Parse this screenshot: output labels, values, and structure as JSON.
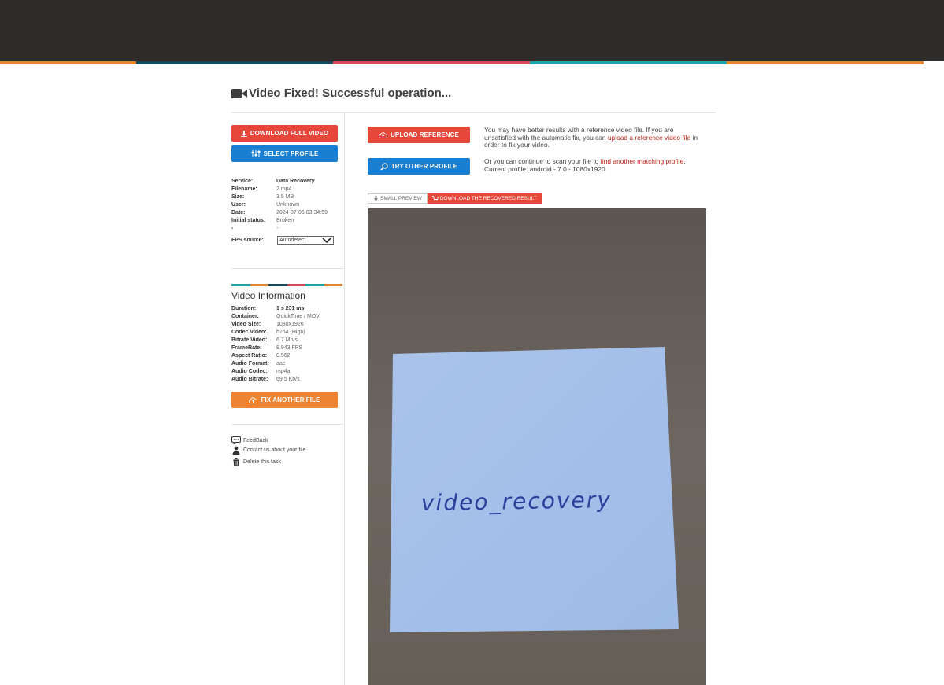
{
  "header": {
    "stripe_colors": [
      "#e58630",
      "#16485c",
      "#d8485a",
      "#1ba7a7",
      "#e58630"
    ]
  },
  "page": {
    "title": "Video Fixed! Successful operation..."
  },
  "actions": {
    "download_full_video": "DOWNLOAD FULL VIDEO",
    "select_profile": "SELECT PROFILE",
    "upload_reference": "UPLOAD REFERENCE",
    "try_other_profile": "TRY OTHER PROFILE",
    "fix_another_file": "FIX ANOTHER FILE"
  },
  "file_info": {
    "service_label": "Service:",
    "service": "Data Recovery",
    "filename_label": "Filename:",
    "filename": "2.mp4",
    "size_label": "Size:",
    "size": "3.5 MB",
    "user_label": "User:",
    "user": "Unknown",
    "date_label": "Date:",
    "date": "2024-07-05 03:34:59",
    "initial_status_label": "Initial status:",
    "initial_status": "Broken",
    "dash_label": "-",
    "dash_value": "-",
    "fps_source_label": "FPS source:",
    "fps_source": "Autodetect"
  },
  "video_info": {
    "title": "Video Information",
    "duration_label": "Duration:",
    "duration": "1 s 231 ms",
    "container_label": "Container:",
    "container": "QuickTime / MOV",
    "video_size_label": "Video Size:",
    "video_size": "1080x1920",
    "codec_video_label": "Codec Video:",
    "codec_video": "h264 (High)",
    "bitrate_video_label": "Bitrate Video:",
    "bitrate_video": "6.7 Mb/s",
    "framerate_label": "FrameRate:",
    "framerate": "8.943 FPS",
    "aspect_ratio_label": "Aspect Ratio:",
    "aspect_ratio": "0.562",
    "audio_format_label": "Audio Format:",
    "audio_format": "aac",
    "audio_codec_label": "Audio Codec:",
    "audio_codec": "mp4a",
    "audio_bitrate_label": "Audio Bitrate:",
    "audio_bitrate": "69.5 Kb/s"
  },
  "links": {
    "feedback": "FeedBack",
    "contact": "Contact us about your file",
    "delete": "Delete this task"
  },
  "notes": {
    "reference_pre": "You may have better results with a reference video file. If you are unsatisfied with the automatic fix, you can ",
    "reference_link": "upload a reference video file",
    "reference_post": " in order to fix your video.",
    "profile_pre": "Or you can continue to scan your file to ",
    "profile_link": "find another matching profile",
    "profile_post": ". Current profile: android - 7.0 - 1080x1920"
  },
  "preview_tabs": {
    "small_preview": "SMALL PREVIEW",
    "download_result": "DOWNLOAD THE RECOVERED RESULT"
  },
  "preview": {
    "handwriting": "video_recovery"
  }
}
